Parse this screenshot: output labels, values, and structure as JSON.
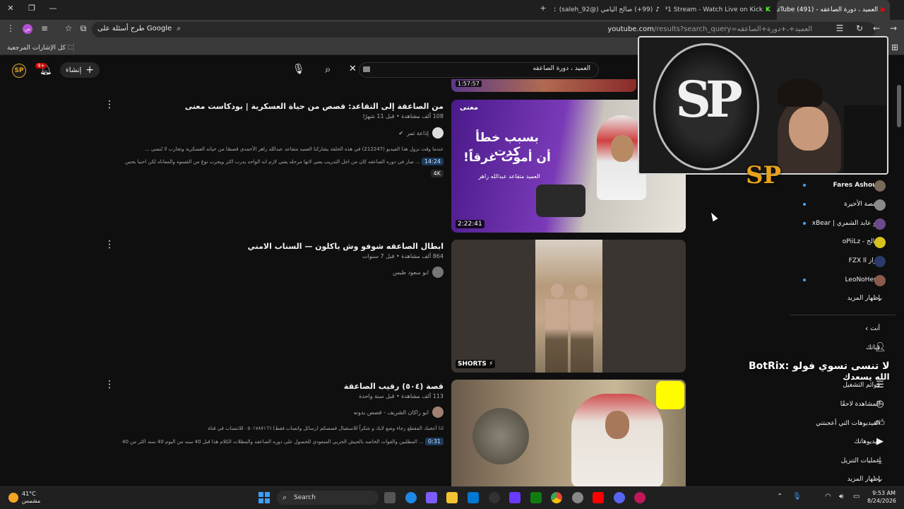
{
  "browser": {
    "tabs": [
      {
        "title": "العميد ، دورة الصاعقه - (491) YouTube",
        "active": true
      },
      {
        "title": "SalehP1 Stream - Watch Live on Kick",
        "active": false
      },
      {
        "title": "(99+) صالح اليامي (@saleh_92)",
        "active": false
      }
    ],
    "url_host": "youtube.com",
    "url_path": "/results?search_query=العميد+،+دورة+الصاعقه",
    "ask_google": "طرح أسئلة على Google",
    "all_bookmarks": "كل الإشارات المرجعية"
  },
  "youtube": {
    "search_value": "العميد ، دورة الصاعقه",
    "create_label": "إنشاء",
    "notif_count": "9+",
    "avatar_text": "SP",
    "top_clip_duration": "1:57:57",
    "videos": [
      {
        "title": "من الصاعقة إلى التقاعد: قصص من حياة العسكرية | بودكاست معنى",
        "meta": "108 ألف مشاهدة • قبل 11 شهرًا",
        "channel": "إذاعة ثمر",
        "desc1": "عندما وقت نزول هذا الفيديو (212247) في هذه الحلقة يشاركنا العميد متقاعد عبدالله راهر الأحمدي قصصًا من حياته العسكرية وتجارب لا تُنسى ...",
        "desc2": "... صار في دوره الصاعقه كان من اجل التدريب يعني لانها مرحله يعني لازم انه الواحد يدرب اكثر ويجرب نوع من القسوه والمعاناه لكن احنيا بحس",
        "chip1": "14:24",
        "chip2": "4K",
        "duration": "2:22:41",
        "thumb_text1": "بسبب خطأ كدت",
        "thumb_text2": "أن أموت غرقاً!",
        "thumb_text3": "العميد متقاعد عبدالله زاهر",
        "thumb_brand": "معنى"
      },
      {
        "title": "ابطال الصاعقه شوفو وش ياكلون — السناب الامني",
        "meta": "864 ألف مشاهدة • قبل 7 سنوات",
        "channel": "ابو سعود طيس",
        "shorts": "SHORTS"
      },
      {
        "title": "قصة (٥٠٤) رقيب الصاعقة",
        "meta": "113 ألف مشاهدة • قبل سنة واحدة",
        "channel": "ابو راكان الشريف - قصص بدونه",
        "desc1": "اذا أعجبك المقطع رجاء وضع لايك و شكراً للاستقبال قصصكم (رسائل واتساب فقط) ٠٥٠١٧٨٧١٦٦ للانتساب في قناة",
        "desc2": "... المطلبين والقوات الخاصه بالجيش الحربي السعودي للحصول على دوره الصاعقه والمظلات الكلام هذا قبل 40 سنه من اليوم 40 سنه اكثر من 40",
        "chip1": "0:31"
      }
    ],
    "subscriptions": [
      {
        "name": "Fares Ashour",
        "live": true,
        "color": "#7a6a5a"
      },
      {
        "name": "القصة الأخيرة",
        "live": true,
        "color": "#8a8a8a"
      },
      {
        "name": "ابو عابد الشمري | xBear",
        "live": true,
        "color": "#6a4a8a"
      },
      {
        "name": "سالح - oPiiLz",
        "live": false,
        "color": "#d8c21a"
      },
      {
        "name": "فراز FZX ll",
        "live": false,
        "color": "#2a3a6a"
      },
      {
        "name": "LeoNoHero",
        "live": true,
        "color": "#8a5a4a"
      }
    ],
    "show_more": "إظهار المزيد",
    "you_section": "أنت",
    "you_items": [
      {
        "label": "قناتك",
        "icon": "person-icon"
      },
      {
        "label": "السجل",
        "icon": "history-icon"
      },
      {
        "label": "قوائم التشغيل",
        "icon": "playlist-icon"
      },
      {
        "label": "المشاهدة لاحقًا",
        "icon": "clock-icon"
      },
      {
        "label": "الفيديوهات التي أعجبتني",
        "icon": "like-icon"
      },
      {
        "label": "فيديوهاتك",
        "icon": "video-icon"
      },
      {
        "label": "عمليات التنزيل",
        "icon": "download-icon"
      },
      {
        "label": "إظهار المزيد",
        "icon": "chevron-down-icon"
      }
    ]
  },
  "overlay": {
    "logo_text": "SP",
    "badge_text": "SP",
    "botrix_line1": "لا تنسى تسوي فولو :BotRix",
    "botrix_line2": "الله يسعدك"
  },
  "taskbar": {
    "temp": "41°C",
    "weather": "مشمس",
    "search_label": "Search",
    "time": "9:53 AM",
    "date": "8/24/2026"
  }
}
